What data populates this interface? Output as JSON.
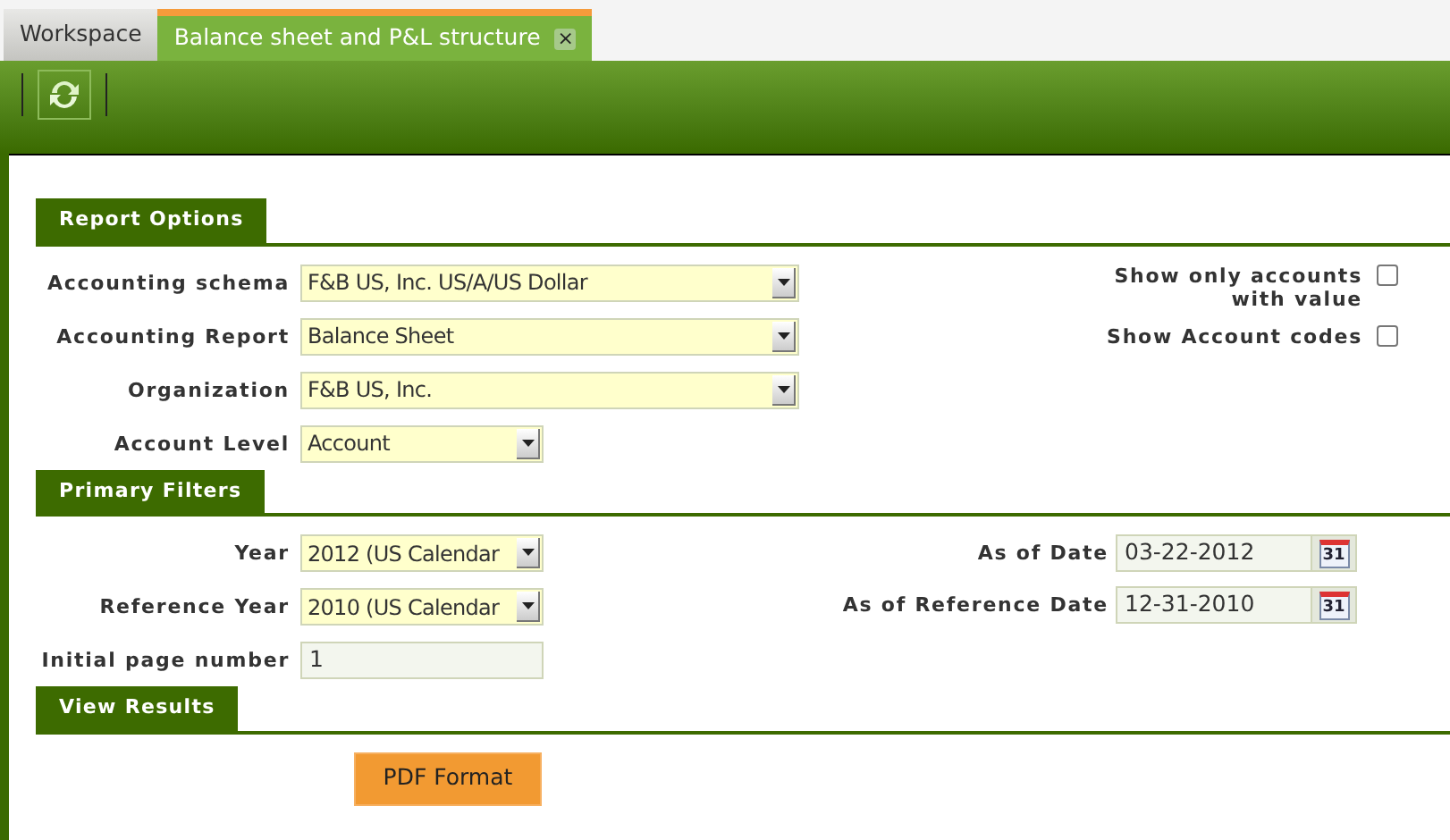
{
  "tabs": [
    {
      "label": "Workspace",
      "selected": false
    },
    {
      "label": "Balance sheet and P&L structure",
      "selected": true,
      "close_glyph": "×"
    }
  ],
  "sections": [
    {
      "title": "Report Options",
      "left": [
        {
          "kind": "wideselect",
          "label": "Accounting schema",
          "value": "F&B US, Inc. US/A/US Dollar"
        },
        {
          "kind": "wideselect",
          "label": "Accounting Report",
          "value": "Balance Sheet"
        },
        {
          "kind": "wideselect",
          "label": "Organization",
          "value": "F&B US, Inc."
        },
        {
          "kind": "select",
          "label": "Account Level",
          "value": "Account"
        }
      ],
      "right": [
        {
          "kind": "checkbox",
          "label": "Show only accounts with value",
          "checked": false
        },
        {
          "kind": "checkbox",
          "label": "Show Account codes",
          "checked": false
        }
      ]
    },
    {
      "title": "Primary Filters",
      "left": [
        {
          "kind": "select",
          "label": "Year",
          "value": "2012 (US Calendar"
        },
        {
          "kind": "select",
          "label": "Reference Year",
          "value": "2010 (US Calendar"
        },
        {
          "kind": "text",
          "label": "Initial page number",
          "value": "1"
        }
      ],
      "right": [
        {
          "kind": "date",
          "label": "As of Date",
          "value": "03-22-2012",
          "icon_text": "31"
        },
        {
          "kind": "date",
          "label": "As of Reference Date",
          "value": "12-31-2010",
          "icon_text": "31"
        }
      ]
    },
    {
      "title": "View Results",
      "buttons": [
        "PDF Format"
      ]
    }
  ]
}
